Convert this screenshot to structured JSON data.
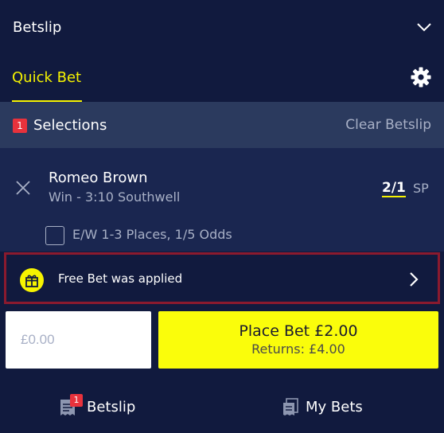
{
  "header": {
    "title": "Betslip"
  },
  "tabs": {
    "quick_bet": "Quick Bet"
  },
  "selections": {
    "count": "1",
    "label": "Selections",
    "clear_label": "Clear Betslip"
  },
  "selection": {
    "runner": "Romeo Brown",
    "market": "Win - 3:10 Southwell",
    "odds": "2/1",
    "sp": "SP",
    "each_way": "E/W 1-3 Places, 1/5 Odds"
  },
  "free_bet": {
    "message": "Free Bet was applied"
  },
  "stake": {
    "value": "£0.00"
  },
  "place_bet": {
    "label": "Place Bet £2.00",
    "returns": "Returns:  £4.00"
  },
  "bottom_nav": {
    "betslip_label": "Betslip",
    "betslip_count": "1",
    "my_bets_label": "My Bets"
  },
  "colors": {
    "background": "#111a3e",
    "accent": "#f6f300",
    "place_bet": "#fafd0b",
    "badge": "#e8323c",
    "free_bet_border": "#8b1a2e"
  },
  "icons": [
    "chevron-down-icon",
    "gear-icon",
    "close-icon",
    "gift-icon",
    "chevron-right-icon",
    "receipt-icon",
    "mybets-icon"
  ]
}
